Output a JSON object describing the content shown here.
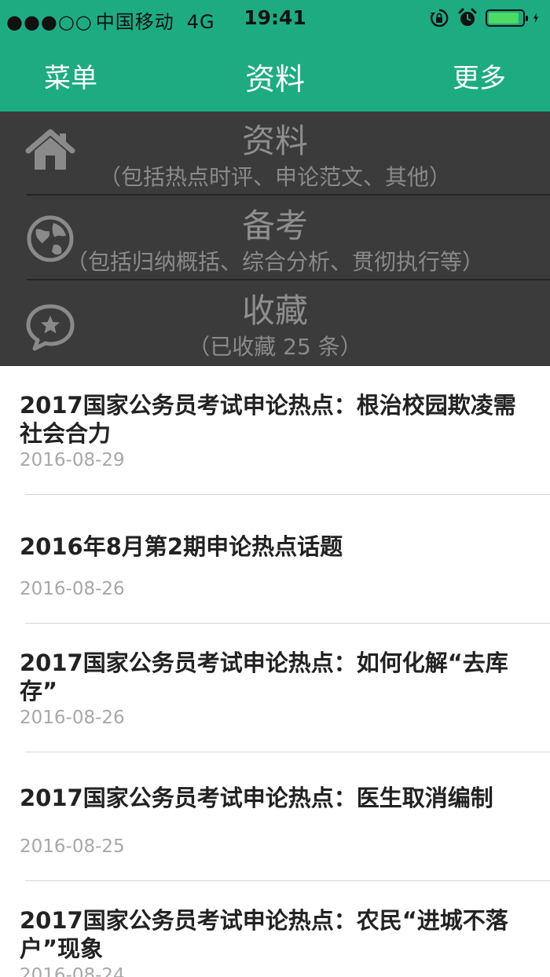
{
  "status_bar": {
    "signal": "●●●○○",
    "carrier": "中国移动",
    "network": "4G",
    "time": "19:41",
    "icons": [
      "orientation-lock-icon",
      "alarm-icon",
      "battery-icon",
      "charging-icon"
    ],
    "battery_level": 0.9
  },
  "nav": {
    "left_label": "菜单",
    "title": "资料",
    "right_label": "更多"
  },
  "menu": {
    "items": [
      {
        "icon": "home-icon",
        "title": "资料",
        "subtitle": "（包括热点时评、申论范文、其他）"
      },
      {
        "icon": "globe-icon",
        "title": "备考",
        "subtitle": "（包括归纳概括、综合分析、贯彻执行等）"
      },
      {
        "icon": "favorites-chat-icon",
        "title": "收藏",
        "subtitle": "（已收藏 25 条）"
      }
    ]
  },
  "articles": [
    {
      "title": "2017国家公务员考试申论热点：根治校园欺凌需社会合力",
      "date": "2016-08-29"
    },
    {
      "title": "2016年8月第2期申论热点话题",
      "date": "2016-08-26"
    },
    {
      "title": "2017国家公务员考试申论热点：如何化解“去库存”",
      "date": "2016-08-26"
    },
    {
      "title": "2017国家公务员考试申论热点：医生取消编制",
      "date": "2016-08-25"
    },
    {
      "title": "2017国家公务员考试申论热点：农民“进城不落户”现象",
      "date": "2016-08-24"
    }
  ],
  "colors": {
    "header_green": "#1dab82",
    "menu_background": "#3b3b3b",
    "date_gray": "#a8a8a8"
  }
}
